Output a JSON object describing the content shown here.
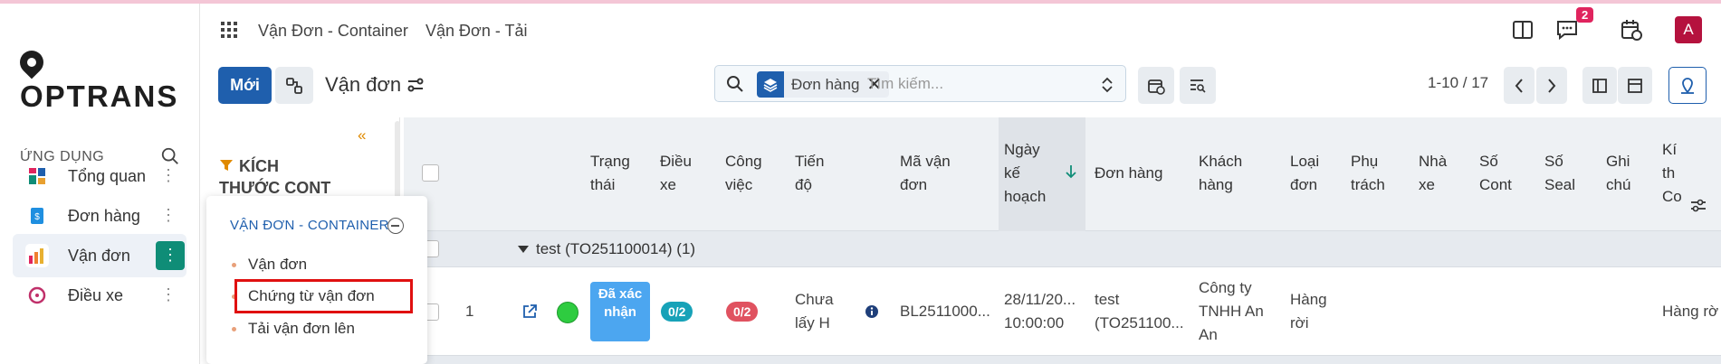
{
  "app": {
    "logo_text": "OPTRANS",
    "avatar_letter": "A",
    "notification_count": "2"
  },
  "topnav": {
    "item1": "Vận Đơn - Container",
    "item2": "Vận Đơn - Tải"
  },
  "sidebar": {
    "apps_label": "ỨNG DỤNG",
    "items": [
      {
        "label": "Tổng quan",
        "icon": "dashboard-icon"
      },
      {
        "label": "Đơn hàng",
        "icon": "order-icon"
      },
      {
        "label": "Vận đơn",
        "icon": "bar-chart-icon"
      },
      {
        "label": "Điều xe",
        "icon": "steering-wheel-icon"
      }
    ]
  },
  "control": {
    "new_label": "Mới",
    "page_title": "Vận đơn",
    "facet_label": "Đơn hàng",
    "search_placeholder": "Tìm kiếm...",
    "pager": "1-10 / 17"
  },
  "filter": {
    "title": "KÍCH THƯỚC CONT"
  },
  "dropdown": {
    "header": "VẬN ĐƠN - CONTAINER",
    "items": [
      "Vận đơn",
      "Chứng từ vận đơn",
      "Tải vận đơn lên"
    ]
  },
  "table": {
    "headers": {
      "status": "Trạng thái",
      "dispatch": "Điều xe",
      "jobs": "Công việc",
      "progress": "Tiến độ",
      "code": "Mã vận đơn",
      "plan_date": "Ngày kế hoạch",
      "order": "Đơn hàng",
      "customer": "Khách hàng",
      "type": "Loại đơn",
      "owner": "Phụ trách",
      "carrier": "Nhà xe",
      "cont_no": "Số Cont",
      "seal_no": "Số Seal",
      "note": "Ghi chú",
      "size_partial": "Kí th Co"
    },
    "group": "test (TO251100014) (1)",
    "row": {
      "index": "1",
      "status": "Đã xác nhận",
      "dispatch": "0/2",
      "jobs": "0/2",
      "progress": "Chưa lấy H",
      "code": "BL2511000...",
      "date": "28/11/20...",
      "time": "10:00:00",
      "order": "test (TO251100...",
      "customer": "Công ty TNHH An An",
      "type": "Hàng rời",
      "size": "Hàng rờ"
    }
  },
  "colors": {
    "primary": "#1f5fad",
    "accent_teal": "#0f8d77",
    "status_blue": "#4ca6f0",
    "chip_teal": "#17a2b8",
    "chip_red": "#e05260",
    "highlight_red": "#e01010"
  }
}
